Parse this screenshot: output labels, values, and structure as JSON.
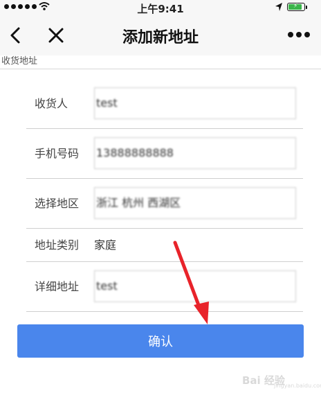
{
  "status_bar": {
    "time": "上午9:41",
    "signal_icon": "signal-dots-icon",
    "wifi_icon": "wifi-icon",
    "location_icon": "location-arrow-icon",
    "battery_icon": "battery-charging-icon",
    "battery_level": 0.85
  },
  "nav": {
    "title": "添加新地址",
    "back_icon": "chevron-left-icon",
    "close_icon": "close-icon",
    "more_icon": "more-dots-icon"
  },
  "section_header": "收货地址",
  "form": {
    "recipient": {
      "label": "收货人",
      "value": "test"
    },
    "phone": {
      "label": "手机号码",
      "value": "13888888888"
    },
    "region": {
      "label": "选择地区",
      "value": "浙江 杭州 西湖区"
    },
    "address_type": {
      "label": "地址类别",
      "value": "家庭"
    },
    "detail": {
      "label": "详细地址",
      "value": "test"
    }
  },
  "confirm_button": "确认",
  "watermark": {
    "text": "Bai 经验",
    "sub": "jingyan.baidu.com"
  },
  "colors": {
    "primary": "#4a86ec",
    "arrow": "#e8232a",
    "battery": "#3ab54a"
  }
}
